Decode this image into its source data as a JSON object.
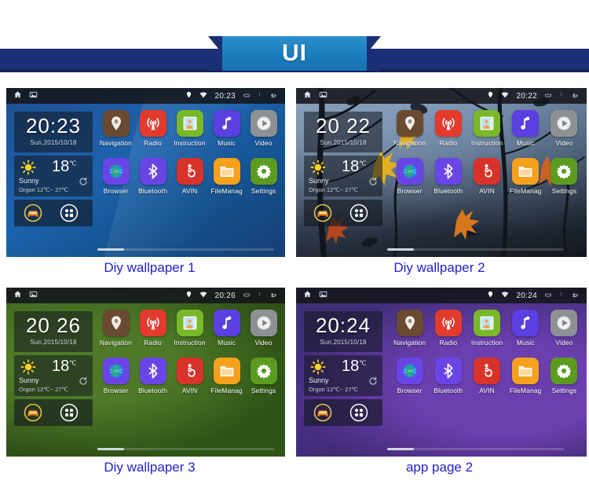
{
  "banner": {
    "title": "UI"
  },
  "panels": [
    {
      "caption": "Diy wallpaper 1",
      "wallpaper": "blue",
      "statusbar": {
        "time": "20:23",
        "icons": [
          "home-icon",
          "screenshot-icon",
          "location-pin-icon",
          "wifi-icon",
          "recents-icon",
          "overflow-menu-icon",
          "back-icon"
        ]
      },
      "clock": {
        "time": "20:23",
        "date": "Sun,2015/10/18"
      },
      "weather": {
        "temp": "18",
        "unit": "C",
        "condition": "Sunny",
        "range": "Orgon 12℃~ 27℃",
        "icon": "sun-icon",
        "refresh": "refresh-icon"
      },
      "dock": {
        "car_icon": "car-icon",
        "apps_icon": "app-drawer-icon"
      },
      "apps_row1": [
        {
          "label": "Navigation",
          "icon": "map-pin-icon",
          "color": "#6b4a32"
        },
        {
          "label": "Radio",
          "icon": "radio-tower-icon",
          "color": "#e23b2e"
        },
        {
          "label": "Instruction",
          "icon": "instruction-book-icon",
          "color": "#78b829"
        },
        {
          "label": "Music",
          "icon": "music-note-icon",
          "color": "#5b3fe0"
        },
        {
          "label": "Video",
          "icon": "play-circle-icon",
          "color": "#8d9094"
        }
      ],
      "apps_row2": [
        {
          "label": "Browser",
          "icon": "globe-icon",
          "color": "#6a45e6"
        },
        {
          "label": "Bluetooth",
          "icon": "bluetooth-icon",
          "color": "#6a45e6"
        },
        {
          "label": "AVIN",
          "icon": "avin-icon",
          "color": "#d8332a"
        },
        {
          "label": "FileManag",
          "icon": "folder-icon",
          "color": "#f5a11e"
        },
        {
          "label": "Settings",
          "icon": "gear-icon",
          "color": "#5b9b20"
        }
      ]
    },
    {
      "caption": "Diy wallpaper 2",
      "wallpaper": "tree",
      "statusbar": {
        "time": "20:22",
        "icons": [
          "home-icon",
          "screenshot-icon",
          "location-pin-icon",
          "wifi-icon",
          "recents-icon",
          "overflow-menu-icon",
          "back-icon"
        ]
      },
      "clock": {
        "time": "20 22",
        "date": "Sun,2015/10/18"
      },
      "weather": {
        "temp": "18",
        "unit": "C",
        "condition": "Sunny",
        "range": "Orgon 12℃~ 27℃",
        "icon": "sun-icon",
        "refresh": "refresh-icon"
      },
      "dock": {
        "car_icon": "car-icon",
        "apps_icon": "app-drawer-icon"
      },
      "apps_row1": [
        {
          "label": "Navigation",
          "icon": "map-pin-icon",
          "color": "#6b4a32"
        },
        {
          "label": "Radio",
          "icon": "radio-tower-icon",
          "color": "#e23b2e"
        },
        {
          "label": "Instruction",
          "icon": "instruction-book-icon",
          "color": "#78b829"
        },
        {
          "label": "Music",
          "icon": "music-note-icon",
          "color": "#5b3fe0"
        },
        {
          "label": "Video",
          "icon": "play-circle-icon",
          "color": "#8d9094"
        }
      ],
      "apps_row2": [
        {
          "label": "Browser",
          "icon": "globe-icon",
          "color": "#6a45e6"
        },
        {
          "label": "Bluetooth",
          "icon": "bluetooth-icon",
          "color": "#6a45e6"
        },
        {
          "label": "AVIN",
          "icon": "avin-icon",
          "color": "#d8332a"
        },
        {
          "label": "FileManag",
          "icon": "folder-icon",
          "color": "#f5a11e"
        },
        {
          "label": "Settings",
          "icon": "gear-icon",
          "color": "#5b9b20"
        }
      ]
    },
    {
      "caption": "Diy wallpaper 3",
      "wallpaper": "green",
      "statusbar": {
        "time": "20:26",
        "icons": [
          "home-icon",
          "screenshot-icon",
          "location-pin-icon",
          "wifi-icon",
          "recents-icon",
          "overflow-menu-icon",
          "back-icon"
        ]
      },
      "clock": {
        "time": "20 26",
        "date": "Sun,2015/10/18"
      },
      "weather": {
        "temp": "18",
        "unit": "C",
        "condition": "Sunny",
        "range": "Orgon 12℃~ 27℃",
        "icon": "sun-icon",
        "refresh": "refresh-icon"
      },
      "dock": {
        "car_icon": "car-icon",
        "apps_icon": "app-drawer-icon"
      },
      "apps_row1": [
        {
          "label": "Navigation",
          "icon": "map-pin-icon",
          "color": "#6b4a32"
        },
        {
          "label": "Radio",
          "icon": "radio-tower-icon",
          "color": "#e23b2e"
        },
        {
          "label": "Instruction",
          "icon": "instruction-book-icon",
          "color": "#78b829"
        },
        {
          "label": "Music",
          "icon": "music-note-icon",
          "color": "#5b3fe0"
        },
        {
          "label": "Video",
          "icon": "play-circle-icon",
          "color": "#8d9094"
        }
      ],
      "apps_row2": [
        {
          "label": "Browser",
          "icon": "globe-icon",
          "color": "#6a45e6"
        },
        {
          "label": "Bluetooth",
          "icon": "bluetooth-icon",
          "color": "#6a45e6"
        },
        {
          "label": "AVIN",
          "icon": "avin-icon",
          "color": "#d8332a"
        },
        {
          "label": "FileManag",
          "icon": "folder-icon",
          "color": "#f5a11e"
        },
        {
          "label": "Settings",
          "icon": "gear-icon",
          "color": "#5b9b20"
        }
      ]
    },
    {
      "caption": "app page 2",
      "wallpaper": "purple",
      "statusbar": {
        "time": "20:24",
        "icons": [
          "home-icon",
          "screenshot-icon",
          "location-pin-icon",
          "wifi-icon",
          "recents-icon",
          "overflow-menu-icon",
          "back-icon"
        ]
      },
      "clock": {
        "time": "20:24",
        "date": "Sun,2015/10/18"
      },
      "weather": {
        "temp": "18",
        "unit": "C",
        "condition": "Sunny",
        "range": "Orgon 12℃~ 27℃",
        "icon": "sun-icon",
        "refresh": "refresh-icon"
      },
      "dock": {
        "car_icon": "car-icon",
        "apps_icon": "app-drawer-icon"
      },
      "apps_row1": [
        {
          "label": "Navigation",
          "icon": "map-pin-icon",
          "color": "#6b4a32"
        },
        {
          "label": "Radio",
          "icon": "radio-tower-icon",
          "color": "#e23b2e"
        },
        {
          "label": "Instruction",
          "icon": "instruction-book-icon",
          "color": "#78b829"
        },
        {
          "label": "Music",
          "icon": "music-note-icon",
          "color": "#5b3fe0"
        },
        {
          "label": "Video",
          "icon": "play-circle-icon",
          "color": "#8d9094"
        }
      ],
      "apps_row2": [
        {
          "label": "Browser",
          "icon": "globe-icon",
          "color": "#6a45e6"
        },
        {
          "label": "Bluetooth",
          "icon": "bluetooth-icon",
          "color": "#6a45e6"
        },
        {
          "label": "AVIN",
          "icon": "avin-icon",
          "color": "#d8332a"
        },
        {
          "label": "FileManag",
          "icon": "folder-icon",
          "color": "#f5a11e"
        },
        {
          "label": "Settings",
          "icon": "gear-icon",
          "color": "#5b9b20"
        }
      ]
    }
  ]
}
